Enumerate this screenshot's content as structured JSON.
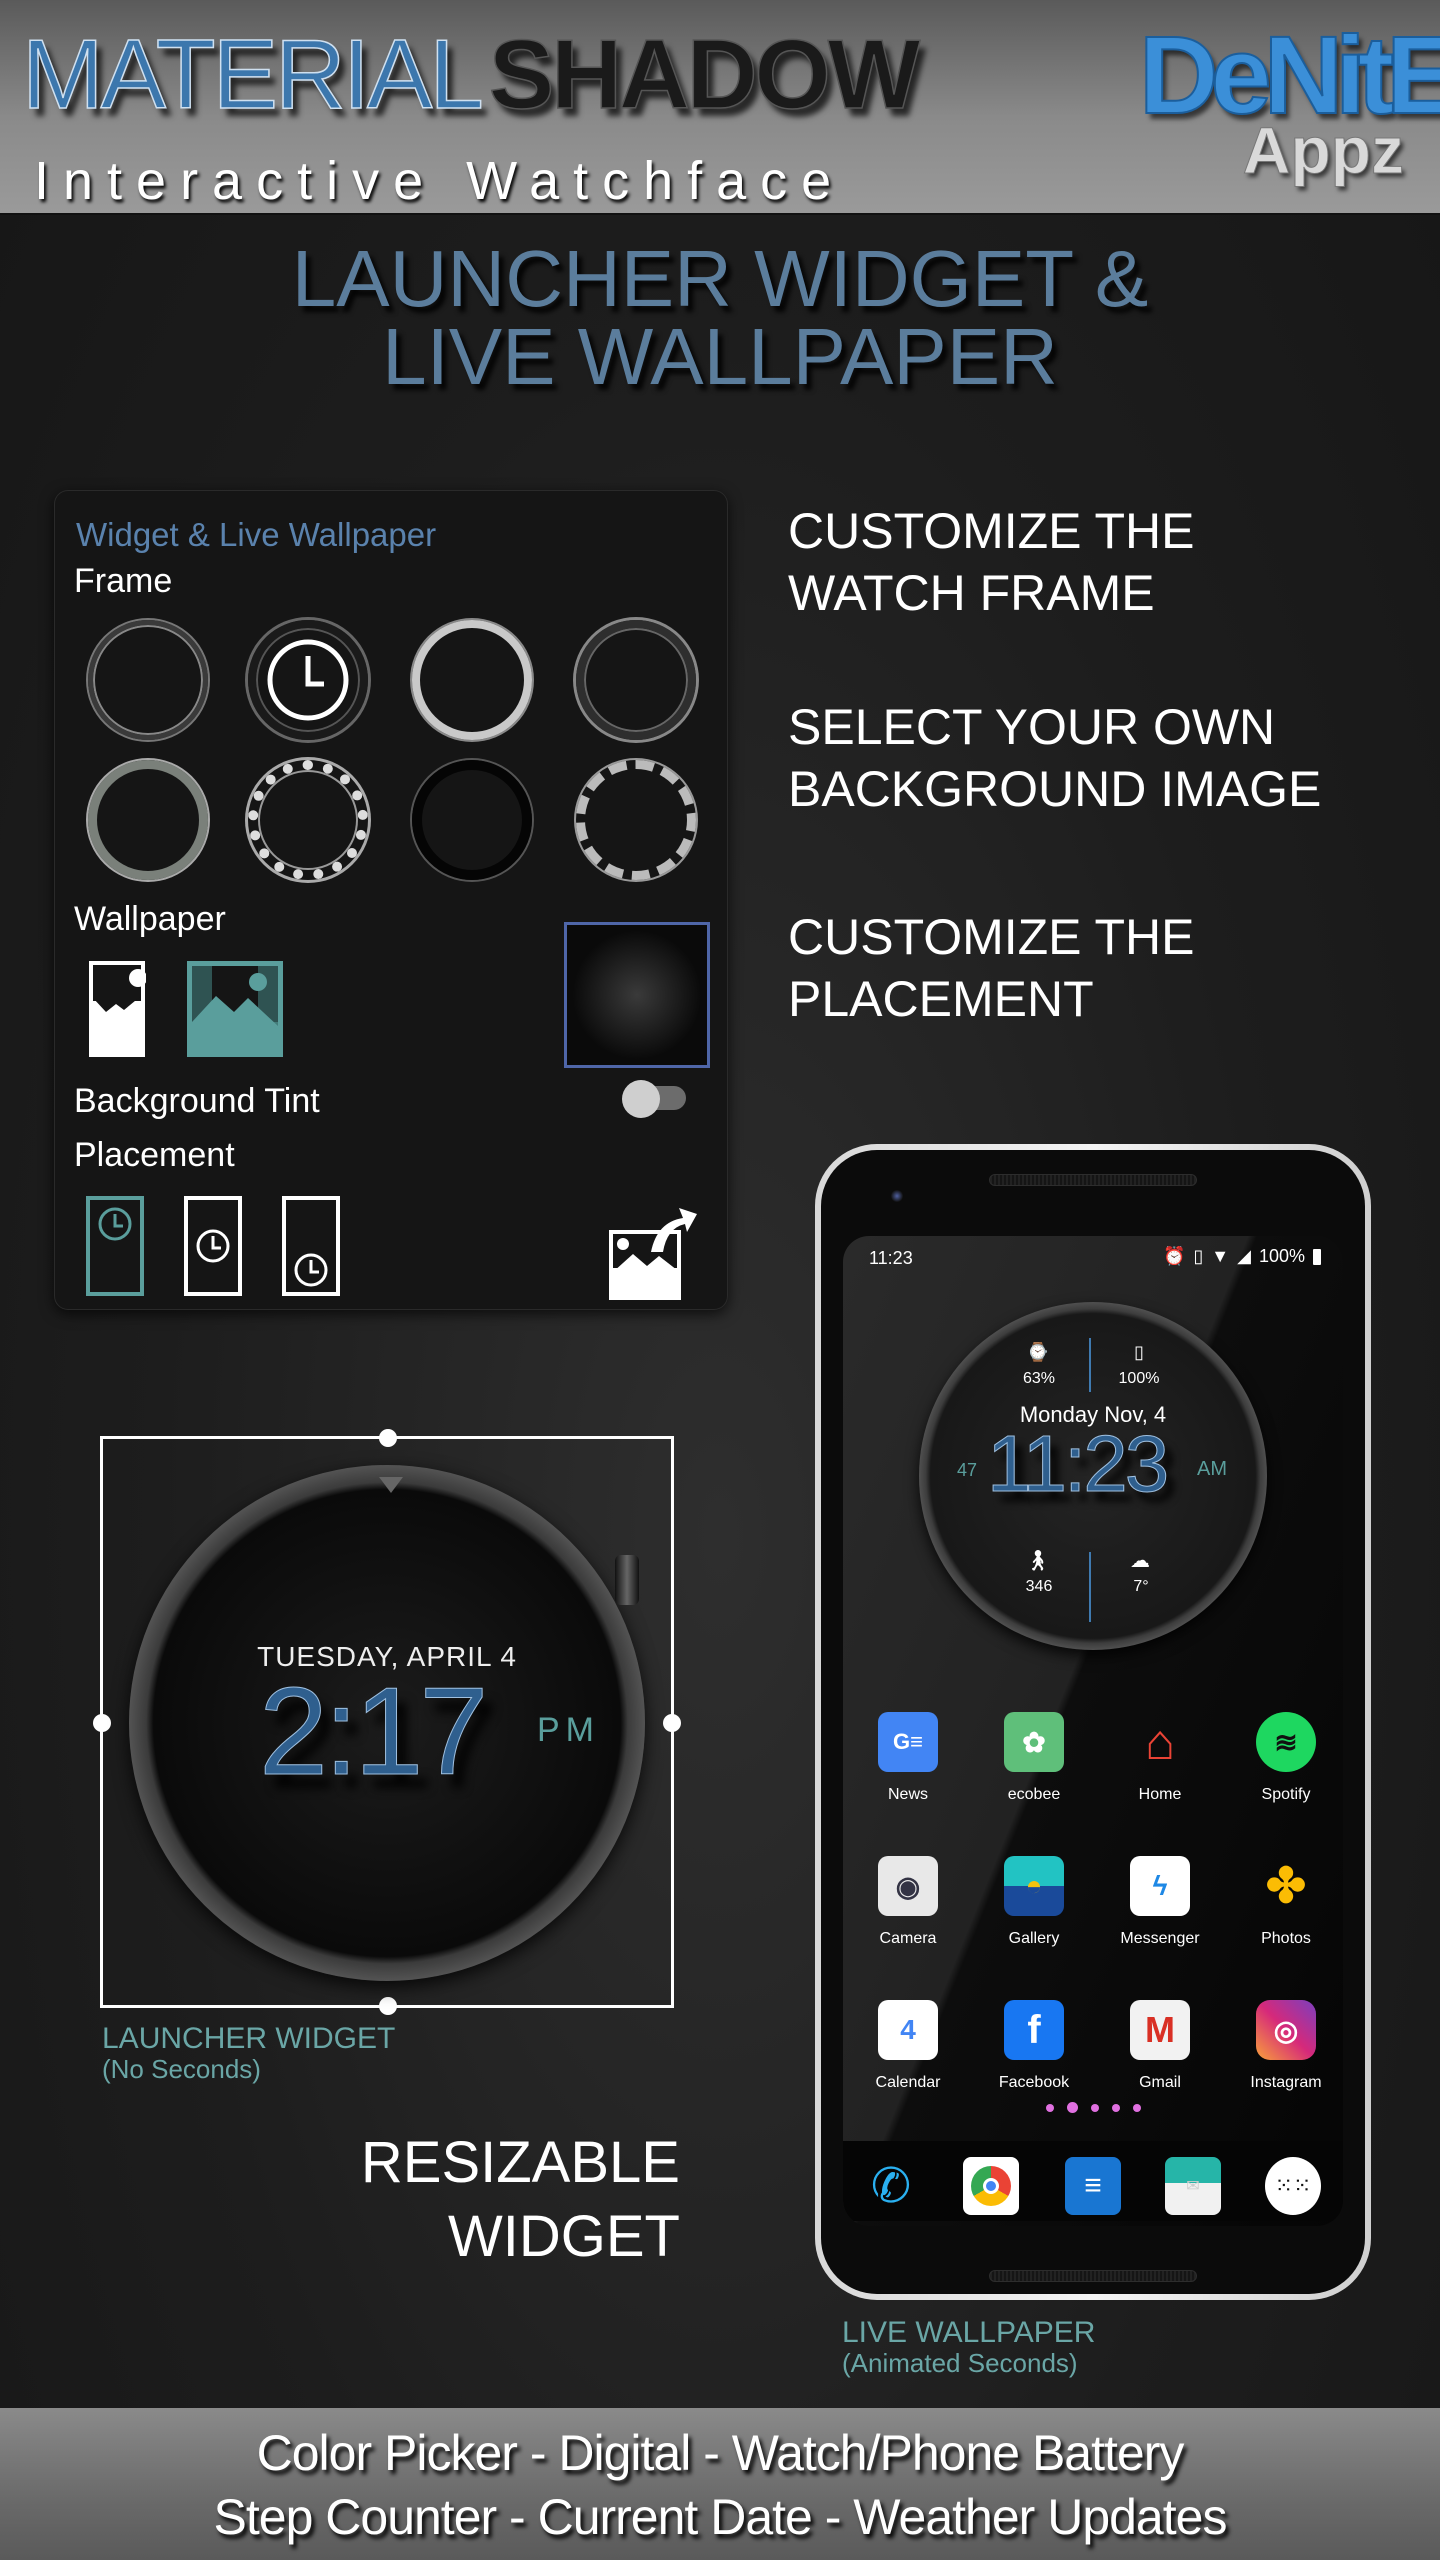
{
  "header": {
    "title_part1": "MATERIAL",
    "title_part2": "SHADOW",
    "subtitle": "Interactive Watchface",
    "logo_main": "DeNitE!",
    "logo_sub": "Appz"
  },
  "headline": {
    "line1": "LAUNCHER WIDGET &",
    "line2": "LIVE WALLPAPER"
  },
  "settings_card": {
    "title": "Widget & Live Wallpaper",
    "frame_label": "Frame",
    "frames": [
      "frame-1",
      "frame-2-selected",
      "frame-3",
      "frame-4",
      "frame-5",
      "frame-6",
      "frame-7",
      "frame-8"
    ],
    "selected_frame_index": 1,
    "wallpaper_label": "Wallpaper",
    "wallpaper_options": [
      "crop-wallpaper-icon",
      "full-wallpaper-icon"
    ],
    "selected_wallpaper_index": 1,
    "background_tint_label": "Background Tint",
    "background_tint_on": false,
    "placement_label": "Placement",
    "placement_options": [
      "top",
      "center",
      "bottom"
    ],
    "selected_placement_index": 0,
    "accent_color": "#5a9e9c",
    "title_color": "#5a82ad"
  },
  "features": [
    {
      "line1": "CUSTOMIZE THE",
      "line2": "WATCH FRAME"
    },
    {
      "line1": "SELECT YOUR OWN",
      "line2": "BACKGROUND IMAGE"
    },
    {
      "line1": "CUSTOMIZE THE",
      "line2": "PLACEMENT"
    }
  ],
  "launcher_widget": {
    "date": "TUESDAY, APRIL 4",
    "time": "2:17",
    "ampm": "PM",
    "label": "LAUNCHER WIDGET",
    "sublabel": "(No Seconds)",
    "resizable_line1": "RESIZABLE",
    "resizable_line2": "WIDGET"
  },
  "phone": {
    "status_time": "11:23",
    "battery": "100%",
    "watch": {
      "watch_battery": "63%",
      "phone_battery": "100%",
      "date": "Monday Nov, 4",
      "time": "11:23",
      "seconds": "47",
      "ampm": "AM",
      "steps": "346",
      "temperature": "7°"
    },
    "apps": [
      {
        "label": "News",
        "color": "#4285f4",
        "glyph": "G≡"
      },
      {
        "label": "ecobee",
        "color": "#5fbf7a",
        "glyph": "✿"
      },
      {
        "label": "Home",
        "color": "#ffffff",
        "glyph": "⌂"
      },
      {
        "label": "Spotify",
        "color": "#1ed760",
        "glyph": "≋"
      },
      {
        "label": "Camera",
        "color": "#e8e8e8",
        "glyph": "◉"
      },
      {
        "label": "Gallery",
        "color": "#1f8fbf",
        "glyph": "◓"
      },
      {
        "label": "Messenger",
        "color": "#ffffff",
        "glyph": "ϟ"
      },
      {
        "label": "Photos",
        "color": "#2a2a2a",
        "glyph": "✤"
      },
      {
        "label": "Calendar",
        "color": "#ffffff",
        "glyph": "4"
      },
      {
        "label": "Facebook",
        "color": "#1877f2",
        "glyph": "f"
      },
      {
        "label": "Gmail",
        "color": "#f2f2f2",
        "glyph": "M"
      },
      {
        "label": "Instagram",
        "color": "#d6297a",
        "glyph": "◎"
      }
    ],
    "page_indicator": {
      "count": 5,
      "current": 2
    },
    "dock": [
      "phone-icon",
      "chrome-icon",
      "messages-icon",
      "email-icon",
      "app-drawer-icon"
    ],
    "label": "LIVE WALLPAPER",
    "sublabel": "(Animated Seconds)"
  },
  "footer": {
    "line1": "Color Picker  -  Digital  -  Watch/Phone Battery",
    "line2": "Step Counter - Current Date - Weather Updates"
  }
}
